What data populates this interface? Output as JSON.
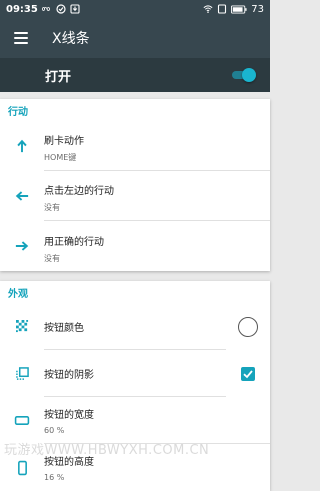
{
  "status_bar": {
    "time": "09:35",
    "battery": "73",
    "icons": [
      "infinity-icon",
      "check-circle-icon",
      "download-icon",
      "wifi-icon",
      "sim-icon",
      "battery-icon"
    ]
  },
  "app_bar": {
    "title": "X线条",
    "menu_icon": "menu-icon"
  },
  "master_switch": {
    "label": "打开",
    "on": true
  },
  "actions_section": {
    "header": "行动",
    "items": [
      {
        "icon": "arrow-up-icon",
        "title": "刷卡动作",
        "subtitle": "HOME键"
      },
      {
        "icon": "arrow-left-icon",
        "title": "点击左边的行动",
        "subtitle": "没有"
      },
      {
        "icon": "arrow-right-icon",
        "title": "用正确的行动",
        "subtitle": "没有"
      }
    ]
  },
  "appearance_section": {
    "header": "外观",
    "items": [
      {
        "icon": "color-pattern-icon",
        "title": "按钮颜色",
        "control": "color-circle"
      },
      {
        "icon": "shadow-icon",
        "title": "按钮的阴影",
        "control": "checkbox",
        "checked": true
      },
      {
        "icon": "width-icon",
        "title": "按钮的宽度",
        "subtitle": "60 %"
      },
      {
        "icon": "height-icon",
        "title": "按钮的高度",
        "subtitle": "16 %"
      }
    ]
  },
  "watermark": "玩游戏WWW.HBWYXH.COM.CN",
  "colors": {
    "accent": "#15a3bb",
    "appbar": "#37474f",
    "switchbar": "#2c3a40",
    "background": "#e9e9e9"
  }
}
